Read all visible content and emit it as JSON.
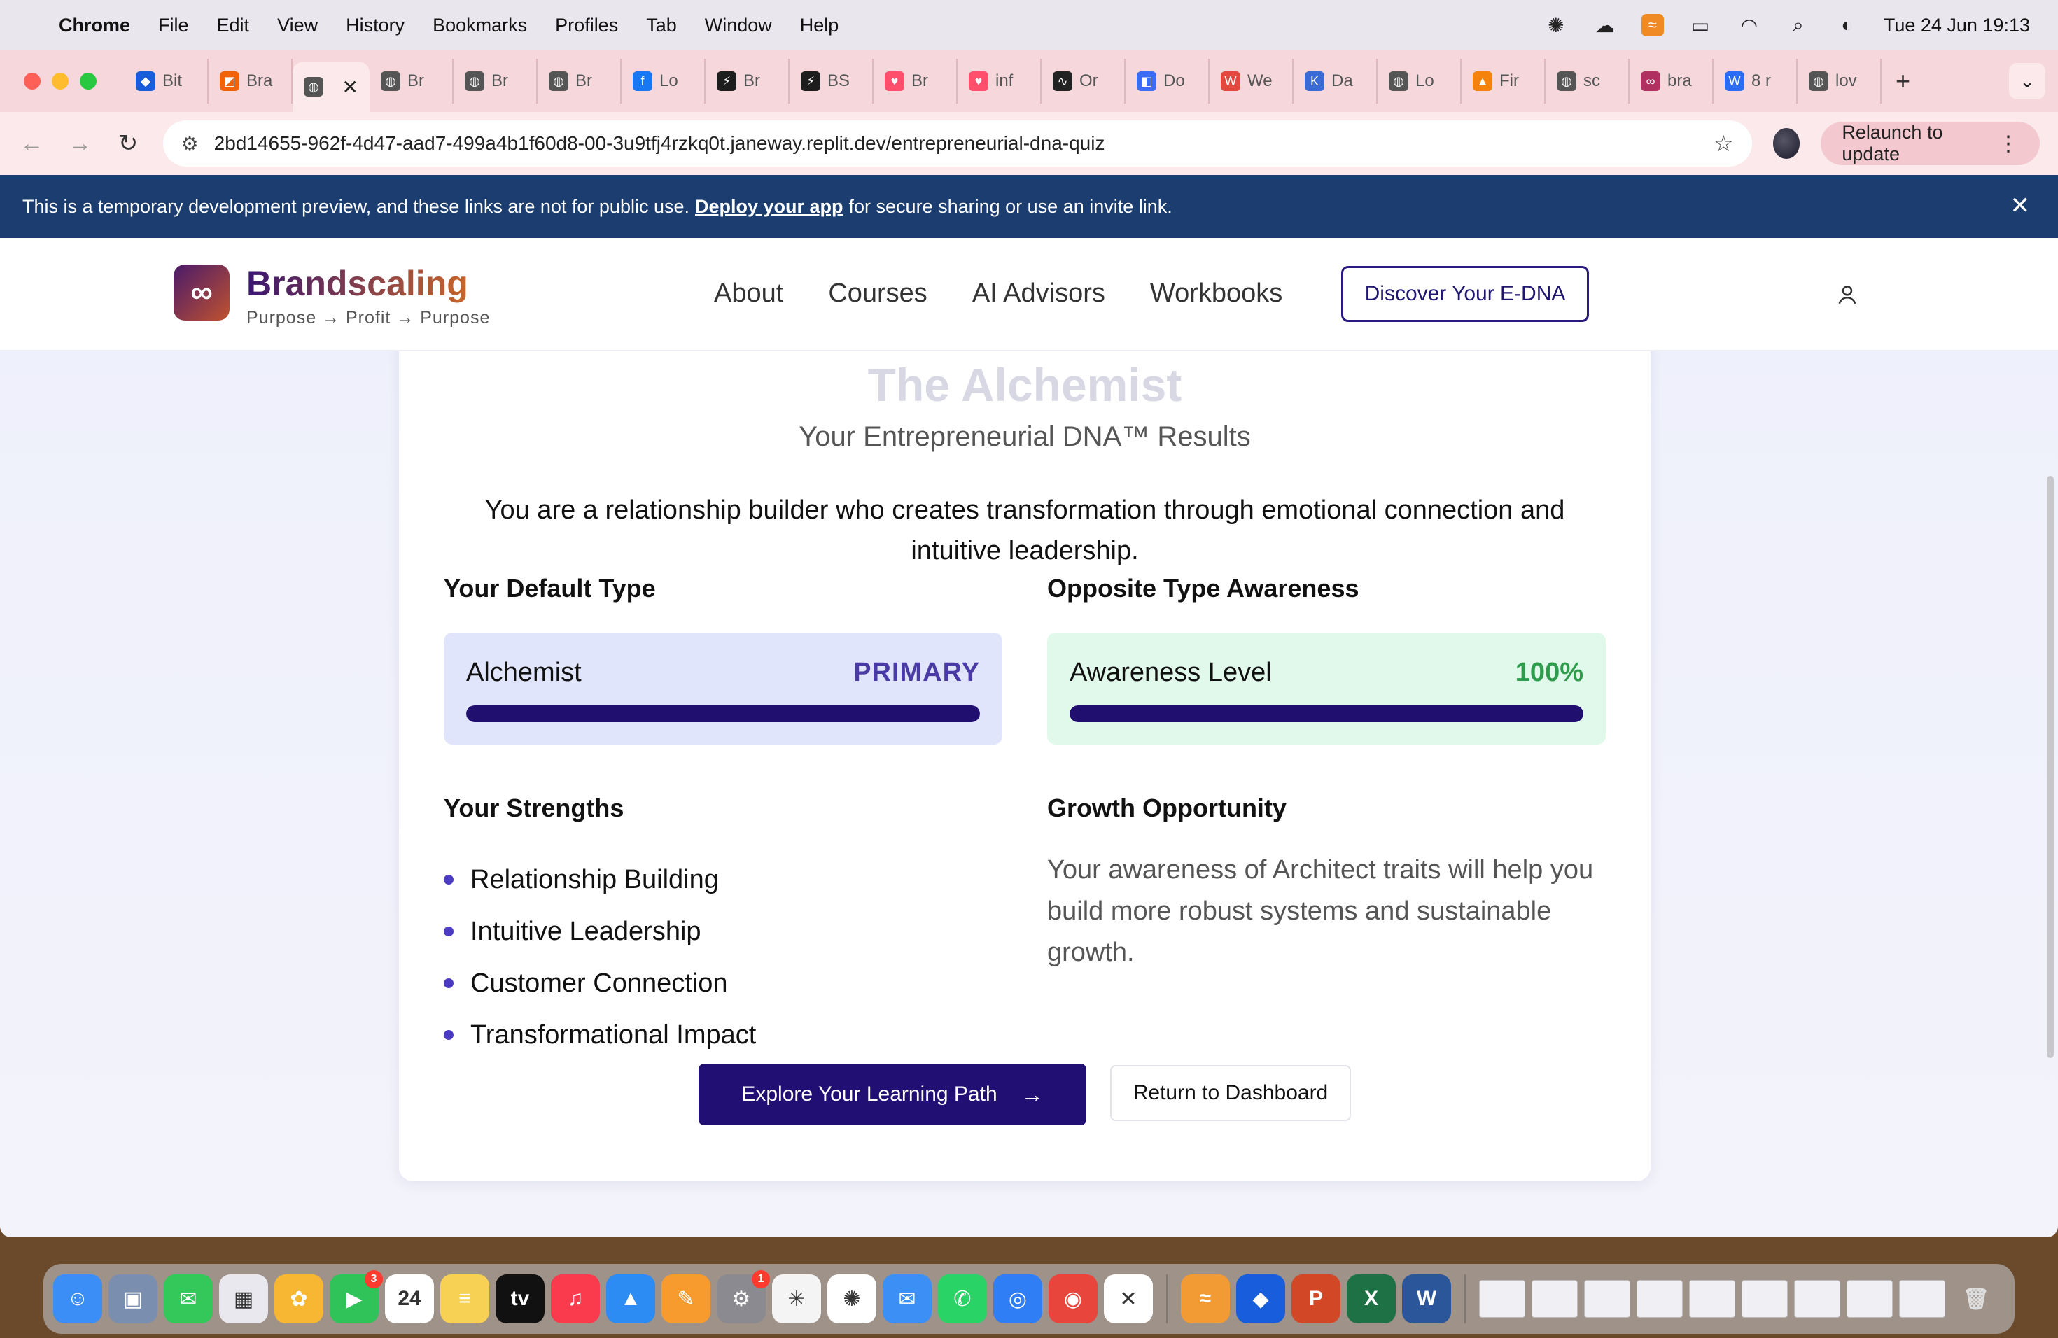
{
  "menubar": {
    "app": "Chrome",
    "menus": [
      "File",
      "Edit",
      "View",
      "History",
      "Bookmarks",
      "Profiles",
      "Tab",
      "Window",
      "Help"
    ],
    "clock": "Tue 24 Jun  19:13"
  },
  "tabs": [
    {
      "label": "Bit",
      "icon": "bitwarden-icon",
      "color": "#175ddc"
    },
    {
      "label": "Bra",
      "icon": "replit-icon",
      "color": "#f26207"
    },
    {
      "label": "",
      "icon": "globe-icon",
      "color": "#555555",
      "active": true
    },
    {
      "label": "Br",
      "icon": "globe-icon",
      "color": "#555555"
    },
    {
      "label": "Br",
      "icon": "globe-icon",
      "color": "#555555"
    },
    {
      "label": "Br",
      "icon": "globe-icon",
      "color": "#555555"
    },
    {
      "label": "Lo",
      "icon": "facebook-icon",
      "color": "#1877f2"
    },
    {
      "label": "Br",
      "icon": "bolt-icon",
      "color": "#1d1d1d"
    },
    {
      "label": "BS",
      "icon": "bolt-icon",
      "color": "#1d1d1d"
    },
    {
      "label": "Br",
      "icon": "lovable-icon",
      "color": "#ff4f6d"
    },
    {
      "label": "inf",
      "icon": "lovable-icon",
      "color": "#ff4f6d"
    },
    {
      "label": "Or",
      "icon": "pulse-icon",
      "color": "#222222"
    },
    {
      "label": "Do",
      "icon": "doc-icon",
      "color": "#3b6cf6"
    },
    {
      "label": "We",
      "icon": "w-icon",
      "color": "#e2483d"
    },
    {
      "label": "Da",
      "icon": "k-icon",
      "color": "#3a6ad6"
    },
    {
      "label": "Lo",
      "icon": "globe-icon",
      "color": "#555555"
    },
    {
      "label": "Fir",
      "icon": "firebase-icon",
      "color": "#f5820d"
    },
    {
      "label": "sc",
      "icon": "globe-icon",
      "color": "#555555"
    },
    {
      "label": "bra",
      "icon": "logo-icon",
      "color": "#b03060"
    },
    {
      "label": "8 r",
      "icon": "w-icon",
      "color": "#2a6df4"
    },
    {
      "label": "lov",
      "icon": "globe-icon",
      "color": "#555555"
    }
  ],
  "toolbar": {
    "url": "2bd14655-962f-4d47-aad7-499a4b1f60d8-00-3u9tfj4rzkq0t.janeway.replit.dev/entrepreneurial-dna-quiz",
    "relaunch": "Relaunch to update"
  },
  "banner": {
    "text_before": "This is a temporary development preview, and these links are not for public use.",
    "link": "Deploy your app",
    "text_after": "for secure sharing or use an invite link."
  },
  "site": {
    "brand": "Brandscaling",
    "tagline": "Purpose → Profit → Purpose",
    "nav": [
      "About",
      "Courses",
      "AI Advisors",
      "Workbooks"
    ],
    "cta": "Discover Your E-DNA"
  },
  "results": {
    "ghost_title": "The Alchemist",
    "subtitle": "Your Entrepreneurial DNA™ Results",
    "description": "You are a relationship builder who creates transformation through emotional connection and intuitive leadership.",
    "default_type": {
      "heading": "Your Default Type",
      "name": "Alchemist",
      "badge": "PRIMARY",
      "level": 1.0
    },
    "opposite": {
      "heading": "Opposite Type Awareness",
      "label": "Awareness Level",
      "value": "100%",
      "level": 1.0
    },
    "strengths": {
      "heading": "Your Strengths",
      "items": [
        "Relationship Building",
        "Intuitive Leadership",
        "Customer Connection",
        "Transformational Impact"
      ]
    },
    "growth": {
      "heading": "Growth Opportunity",
      "text": "Your awareness of Architect traits will help you build more robust systems and sustainable growth."
    },
    "primary_button": "Explore Your Learning Path",
    "secondary_button": "Return to Dashboard"
  },
  "dock": {
    "apps": [
      {
        "name": "finder-icon",
        "color": "#3a8ef6",
        "glyph": "☺"
      },
      {
        "name": "preview-icon",
        "color": "#7a8fb0",
        "glyph": "▣"
      },
      {
        "name": "messages-icon",
        "color": "#34c759",
        "glyph": "✉"
      },
      {
        "name": "launchpad-icon",
        "color": "#e8e8ee",
        "glyph": "▦"
      },
      {
        "name": "photos-icon",
        "color": "#f7b733",
        "glyph": "✿"
      },
      {
        "name": "facetime-icon",
        "color": "#30c35a",
        "glyph": "▶",
        "badge": "3"
      },
      {
        "name": "calendar-icon",
        "color": "#ffffff",
        "glyph": "24"
      },
      {
        "name": "notes-icon",
        "color": "#f7d154",
        "glyph": "≡"
      },
      {
        "name": "appletv-icon",
        "color": "#111111",
        "glyph": "tv"
      },
      {
        "name": "music-icon",
        "color": "#fa3b4e",
        "glyph": "♫"
      },
      {
        "name": "keynote-icon",
        "color": "#2c8cf4",
        "glyph": "▲"
      },
      {
        "name": "pages-icon",
        "color": "#f79b2e",
        "glyph": "✎"
      },
      {
        "name": "system-settings-icon",
        "color": "#8a8a90",
        "glyph": "⚙",
        "badge": "1"
      },
      {
        "name": "claude-icon",
        "color": "#f4f4f4",
        "glyph": "✳"
      },
      {
        "name": "chatgpt-icon",
        "color": "#ffffff",
        "glyph": "✺"
      },
      {
        "name": "mail-icon",
        "color": "#3c8ff5",
        "glyph": "✉"
      },
      {
        "name": "whatsapp-icon",
        "color": "#2ad366",
        "glyph": "✆"
      },
      {
        "name": "safari-icon",
        "color": "#2f7ef5",
        "glyph": "◎"
      },
      {
        "name": "chrome-icon",
        "color": "#e8453c",
        "glyph": "◉"
      },
      {
        "name": "mail-alt-icon",
        "color": "#ffffff",
        "glyph": "✕"
      }
    ],
    "apps_right": [
      {
        "name": "sublime-icon",
        "color": "#f29b35",
        "glyph": "≈"
      },
      {
        "name": "bitwarden-icon",
        "color": "#175ddc",
        "glyph": "◆"
      },
      {
        "name": "powerpoint-icon",
        "color": "#d24726",
        "glyph": "P"
      },
      {
        "name": "excel-icon",
        "color": "#1e7145",
        "glyph": "X"
      },
      {
        "name": "word-icon",
        "color": "#2b579a",
        "glyph": "W"
      }
    ],
    "thumb_count": 9,
    "trash": "trash-icon"
  }
}
